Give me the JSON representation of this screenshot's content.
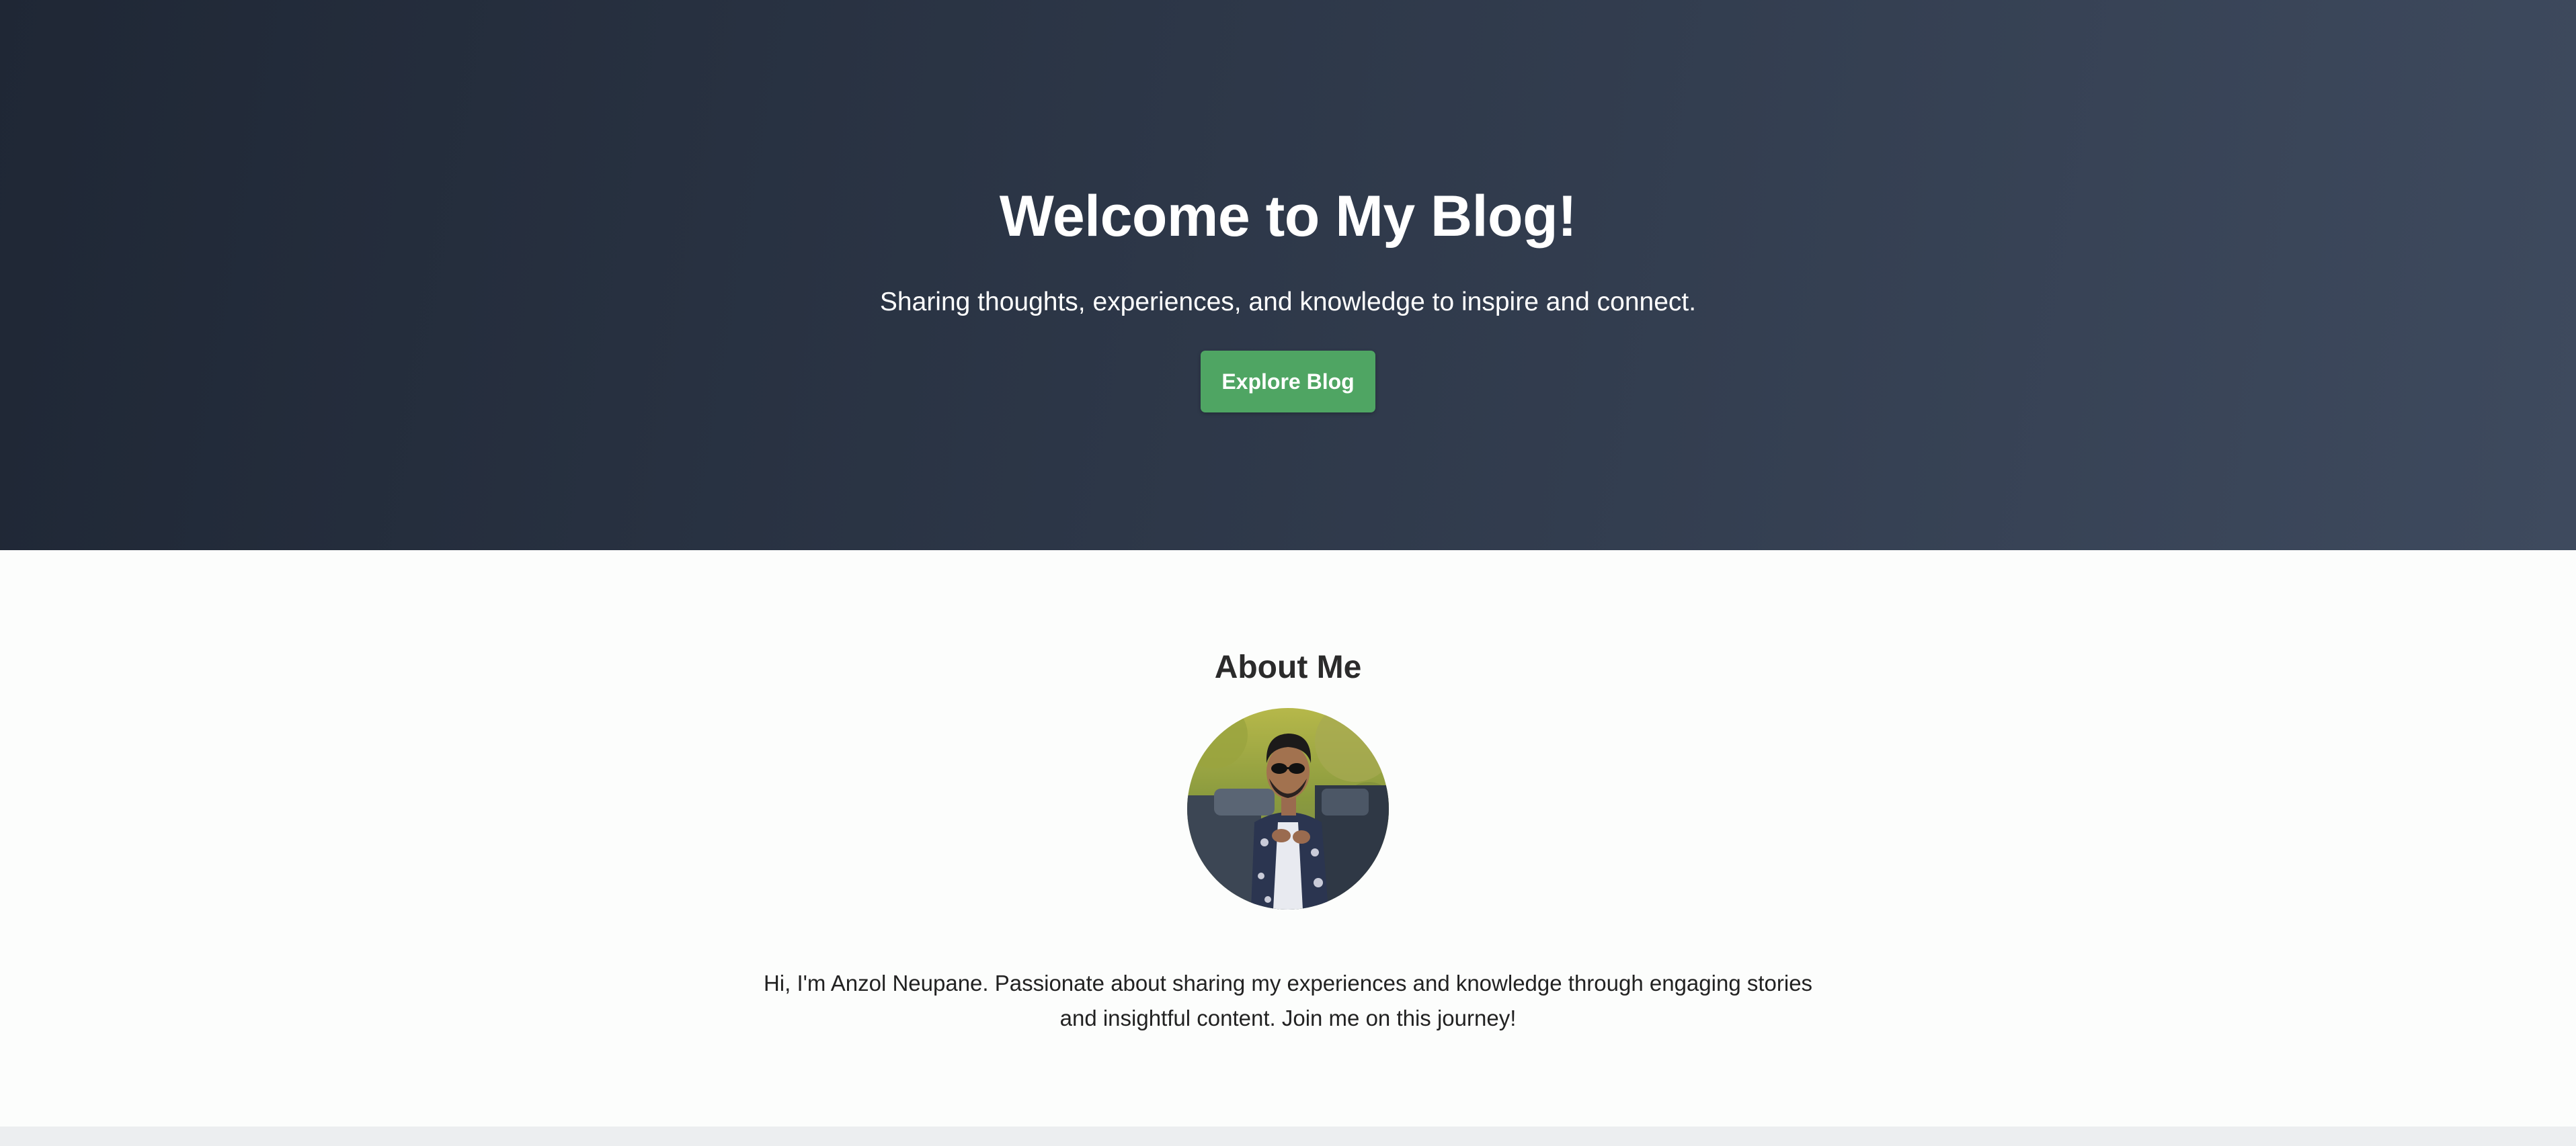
{
  "hero": {
    "title": "Welcome to My Blog!",
    "subtitle": "Sharing thoughts, experiences, and knowledge to inspire and connect.",
    "button_label": "Explore Blog"
  },
  "about": {
    "title": "About Me",
    "avatar_alt": "profile photo",
    "bio": "Hi, I'm Anzol Neupane. Passionate about sharing my experiences and knowledge through engaging stories and insightful content. Join me on this journey!"
  },
  "colors": {
    "hero_gradient_start": "#1f2735",
    "hero_gradient_end": "#3e4a5e",
    "button": "#4fa563",
    "about_background": "#fcfdfc"
  }
}
